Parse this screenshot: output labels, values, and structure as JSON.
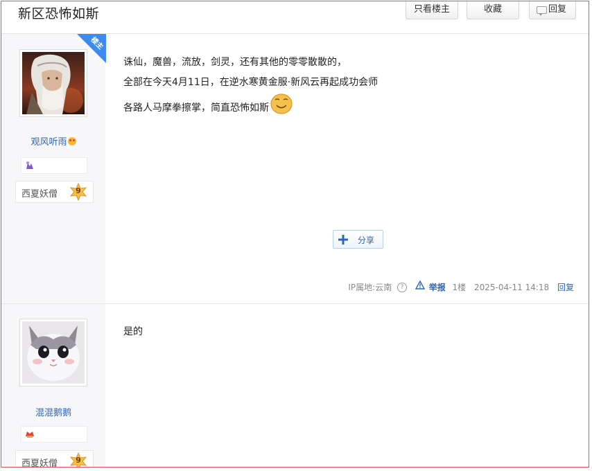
{
  "header": {
    "title": "新区恐怖如斯",
    "buttons": {
      "only_op": "只看楼主",
      "favorite": "收藏",
      "reply": "回复"
    }
  },
  "posts": [
    {
      "username": "观风听雨",
      "badge": "楼主",
      "level_name": "西夏妖僧",
      "level": "9",
      "lines": [
        "诛仙，魔兽，流放，剑灵，还有其他的零零散散的，",
        "全部在今天4月11日，在逆水寒黄金服·新风云再起成功会师",
        "各路人马摩拳擦掌，简直恐怖如斯"
      ],
      "share_label": "分享",
      "ip": "IP属地:云南",
      "report": "举报",
      "floor": "1楼",
      "time": "2025-04-11 14:18",
      "reply": "回复"
    },
    {
      "username": "混混鹅鹅",
      "level_name": "西夏妖僧",
      "level": "9",
      "lines": [
        "是的"
      ]
    }
  ],
  "colors": {
    "link": "#2d64b3",
    "frame": "#e0514f",
    "badge": "#3e8bf0",
    "sidebar": "#f7f7f9"
  },
  "icons": [
    "reply-icon",
    "op-badge",
    "smiley-icon",
    "share-plus-icon",
    "help-icon",
    "warning-icon",
    "level-star-icon"
  ]
}
